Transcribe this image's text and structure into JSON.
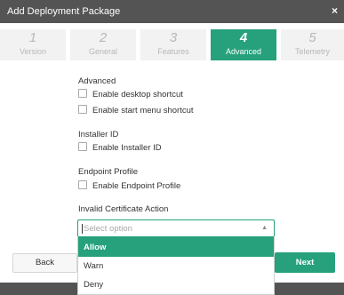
{
  "window": {
    "title": "Add Deployment Package",
    "close_glyph": "×"
  },
  "stepper": [
    {
      "num": "1",
      "label": "Version",
      "active": false
    },
    {
      "num": "2",
      "label": "General",
      "active": false
    },
    {
      "num": "3",
      "label": "Features",
      "active": false
    },
    {
      "num": "4",
      "label": "Advanced",
      "active": true
    },
    {
      "num": "5",
      "label": "Telemetry",
      "active": false
    }
  ],
  "sections": {
    "advanced": {
      "title": "Advanced",
      "options": [
        {
          "label": "Enable desktop shortcut",
          "checked": false
        },
        {
          "label": "Enable start menu shortcut",
          "checked": false
        }
      ]
    },
    "installer": {
      "title": "Installer ID",
      "options": [
        {
          "label": "Enable Installer ID",
          "checked": false
        }
      ]
    },
    "endpoint": {
      "title": "Endpoint Profile",
      "options": [
        {
          "label": "Enable Endpoint Profile",
          "checked": false
        }
      ]
    },
    "invalid_cert": {
      "title": "Invalid Certificate Action",
      "placeholder": "Select option",
      "options": [
        "Allow",
        "Warn",
        "Deny"
      ],
      "highlighted": "Allow"
    }
  },
  "buttons": {
    "back": "Back",
    "next": "Next"
  },
  "colors": {
    "accent": "#26a17b",
    "titlebar": "#545454",
    "step_inactive": "#f2f2f2"
  }
}
